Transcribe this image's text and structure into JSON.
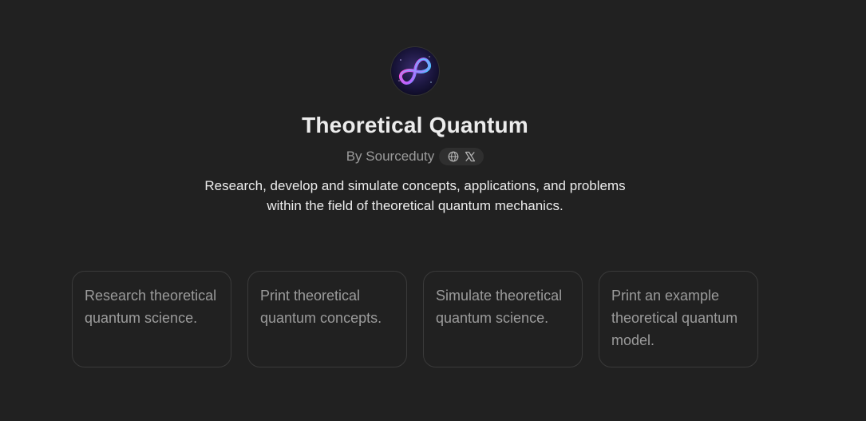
{
  "gpt": {
    "title": "Theoretical Quantum",
    "byline": "By Sourceduty",
    "description": "Research, develop and simulate concepts, applications, and problems within the field of theoretical quantum mechanics.",
    "icons": [
      "globe-icon",
      "x-logo-icon"
    ]
  },
  "conversation_starters": [
    {
      "text": "Research theoretical quantum science."
    },
    {
      "text": "Print theoretical quantum concepts."
    },
    {
      "text": "Simulate theoretical quantum science."
    },
    {
      "text": "Print an example theoretical quantum model."
    }
  ],
  "colors": {
    "background": "#212121",
    "title": "#ececec",
    "muted": "#9b9b9b",
    "card_border": "#3a3a3a",
    "pill_bg": "#2f2f2f"
  }
}
